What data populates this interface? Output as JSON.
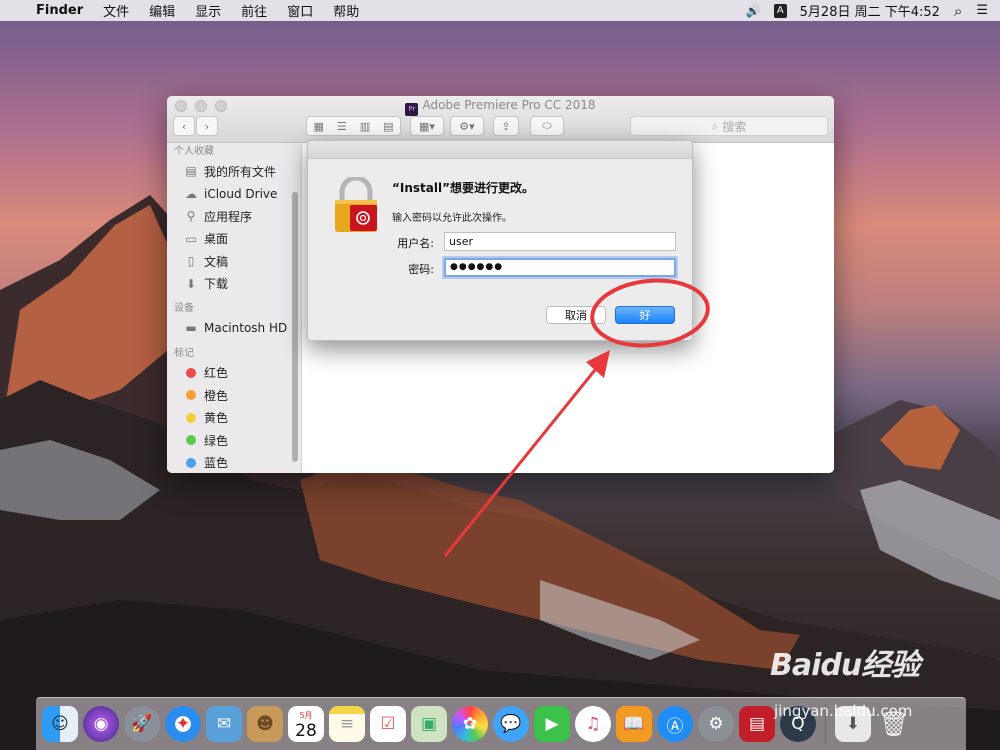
{
  "menubar": {
    "apple": "",
    "app_name": "Finder",
    "items": [
      "文件",
      "编辑",
      "显示",
      "前往",
      "窗口",
      "帮助"
    ],
    "volume": "🔊",
    "input_method": "A",
    "datetime": "5月28日 周二 下午4:52",
    "search": "⌕",
    "menu_extra": "☰"
  },
  "finder": {
    "title": "Adobe Premiere Pro CC 2018",
    "title_icon": "Pr",
    "search_placeholder": "搜索",
    "sidebar": {
      "favorites_header": "个人收藏",
      "favorites": [
        {
          "label": "我的所有文件",
          "icon": "all-files-icon"
        },
        {
          "label": "iCloud Drive",
          "icon": "cloud-icon"
        },
        {
          "label": "应用程序",
          "icon": "applications-icon"
        },
        {
          "label": "桌面",
          "icon": "desktop-icon"
        },
        {
          "label": "文稿",
          "icon": "documents-icon"
        },
        {
          "label": "下载",
          "icon": "downloads-icon"
        }
      ],
      "devices_header": "设备",
      "devices": [
        {
          "label": "Macintosh HD",
          "icon": "disk-icon"
        }
      ],
      "tags_header": "标记",
      "tags": [
        {
          "label": "红色",
          "color": "#ec4a4a"
        },
        {
          "label": "橙色",
          "color": "#f5a033"
        },
        {
          "label": "黄色",
          "color": "#f2cf35"
        },
        {
          "label": "绿色",
          "color": "#5ac84b"
        },
        {
          "label": "蓝色",
          "color": "#4aa0ea"
        }
      ]
    }
  },
  "dialog": {
    "title": "“Install”想要进行更改。",
    "message": "输入密码以允许此次操作。",
    "username_label": "用户名:",
    "username_value": "user",
    "password_label": "密码:",
    "password_value": "●●●●●●",
    "cancel_label": "取消",
    "ok_label": "好"
  },
  "dock": {
    "calendar_month": "5月",
    "calendar_day": "28"
  },
  "watermark": {
    "brand": "Baidu经验",
    "url": "jingyan.baidu.com"
  },
  "colors": {
    "accent": "#1a82fb",
    "annotation_red": "#e8383b"
  }
}
